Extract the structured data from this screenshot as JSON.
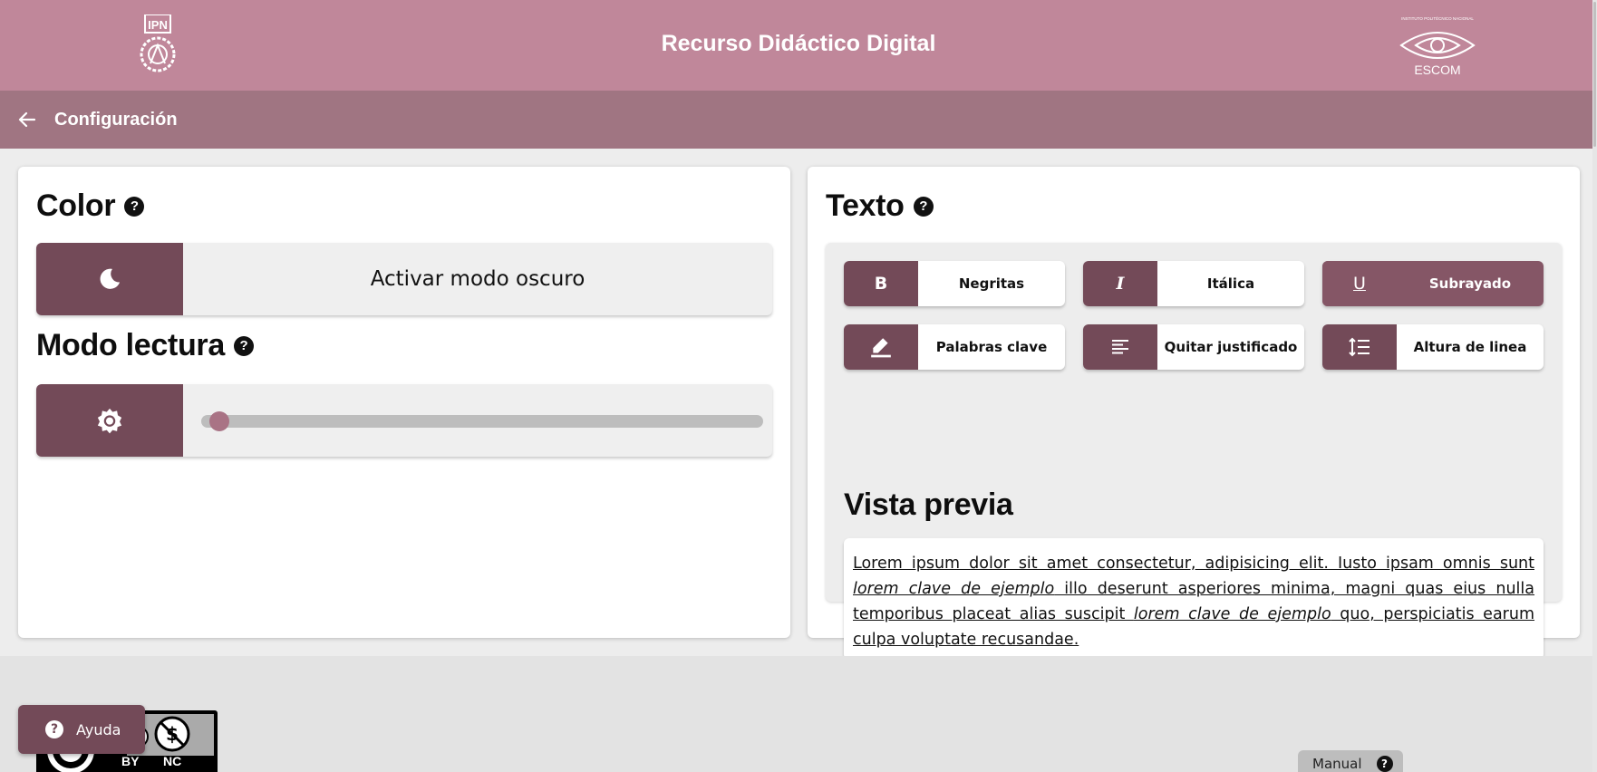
{
  "header": {
    "title": "Recurso Didáctico Digital",
    "left_logo_icon": "ipn-logo-icon",
    "right_logo_icon": "escom-logo-icon",
    "right_logo_text": "ESCOM",
    "right_logo_small_text": "INSTITUTO POLITÉCNICO NACIONAL"
  },
  "subheader": {
    "back_icon": "arrow-left-icon",
    "title": "Configuración"
  },
  "color_section": {
    "title": "Color",
    "help": "?",
    "dark_mode_icon": "moon-icon",
    "dark_mode_label": "Activar modo oscuro"
  },
  "reading_section": {
    "title": "Modo lectura",
    "help": "?",
    "brightness_icon": "brightness-icon",
    "slider_value": 0
  },
  "text_section": {
    "title": "Texto",
    "help": "?",
    "tools": [
      {
        "icon": "bold-icon",
        "glyph": "B",
        "label": "Negritas",
        "active": false
      },
      {
        "icon": "italic-icon",
        "glyph": "I",
        "label": "Itálica",
        "active": false
      },
      {
        "icon": "underline-icon",
        "glyph": "U",
        "label": "Subrayado",
        "active": true
      },
      {
        "icon": "highlighter-icon",
        "label": "Palabras clave",
        "active": false
      },
      {
        "icon": "align-left-icon",
        "label": "Quitar justificado",
        "active": false
      },
      {
        "icon": "line-height-icon",
        "label": "Altura de linea",
        "active": false
      }
    ],
    "preview_title": "Vista previa",
    "preview": {
      "part1": "Lorem ipsum dolor sit amet consectetur, adipisicing elit. Iusto ipsam omnis sunt ",
      "keyword1": "lorem clave de ejemplo",
      "part2": " illo deserunt asperiores minima, magni quas eius nulla temporibus placeat alias suscipit ",
      "keyword2": "lorem clave de ejemplo",
      "part3": " quo, perspiciatis earum culpa voluptate recusandae."
    }
  },
  "footer": {
    "license_by": "BY",
    "license_nc": "NC",
    "help_button": "Ayuda",
    "help_icon": "?",
    "manual_button": "Manual",
    "manual_icon": "?"
  },
  "colors": {
    "header": "#c0879a",
    "subheader": "#a07582",
    "accent": "#734a58",
    "active_tool": "#855666",
    "slider_thumb": "#a97385"
  }
}
